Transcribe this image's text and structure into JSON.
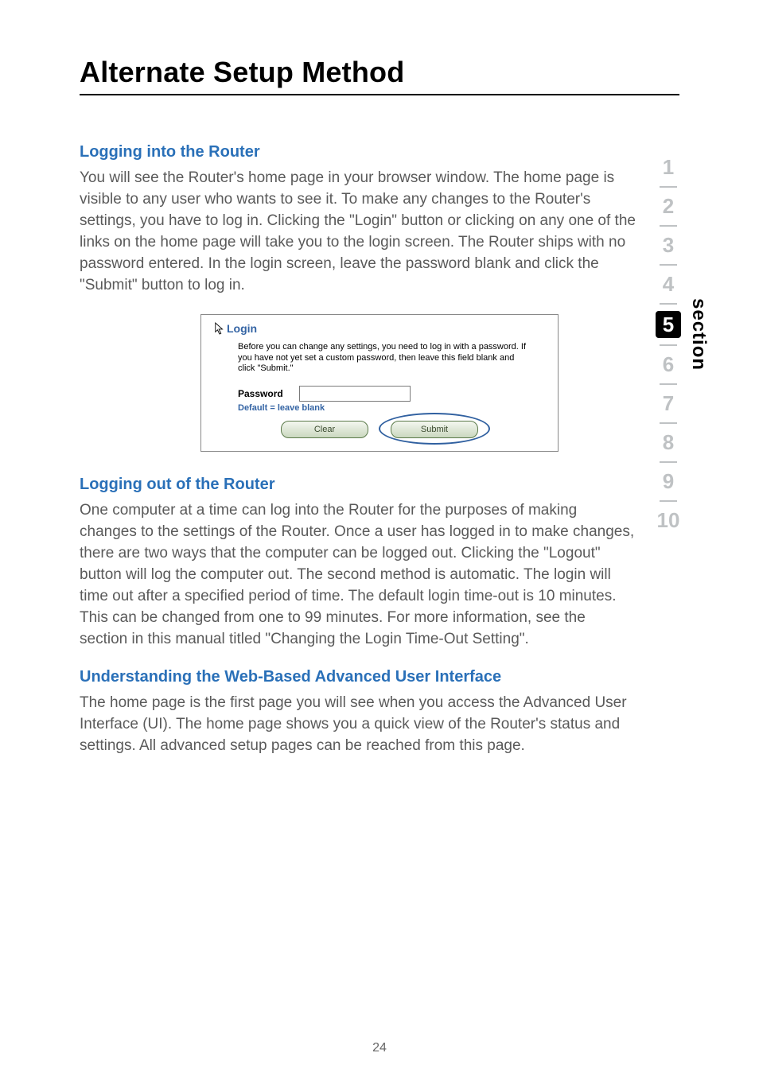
{
  "page_title": "Alternate Setup Method",
  "sections": {
    "login_in": {
      "heading": "Logging into the Router",
      "body": "You will see the Router's home page in your browser window. The home page is visible to any user who wants to see it. To make any changes to the Router's settings, you have to log in. Clicking the \"Login\" button or clicking on any one of the links on the home page will take you to the login screen. The Router ships with no password entered. In the login screen, leave the password blank and click the \"Submit\" button to log in."
    },
    "login_out": {
      "heading": "Logging out of the Router",
      "body": "One computer at a time can log into the Router for the purposes of making changes to the settings of the Router. Once a user has logged in to make changes, there are two ways that the computer can be logged out. Clicking the \"Logout\" button will log the computer out. The second method is automatic. The login will time out after a specified period of time. The default login time-out is 10 minutes. This can be changed from one to 99 minutes. For more information, see the section in this manual titled \"Changing the Login Time-Out Setting\"."
    },
    "understanding": {
      "heading": "Understanding the Web-Based Advanced User Interface",
      "body": "The home page is the first page you will see when you access the Advanced User Interface (UI). The home page shows you a quick view of the Router's status and settings. All advanced setup pages can be reached from this page."
    }
  },
  "login_box": {
    "title": "Login",
    "description": "Before you can change any settings, you need to log in with a password. If you have not yet set a custom password, then leave this field blank and click \"Submit.\"",
    "password_label": "Password",
    "default_hint": "Default = leave blank",
    "clear_btn": "Clear",
    "submit_btn": "Submit"
  },
  "side_nav": {
    "items": [
      "1",
      "2",
      "3",
      "4",
      "5",
      "6",
      "7",
      "8",
      "9",
      "10"
    ],
    "active": "5",
    "section_label": "section"
  },
  "page_number": "24"
}
